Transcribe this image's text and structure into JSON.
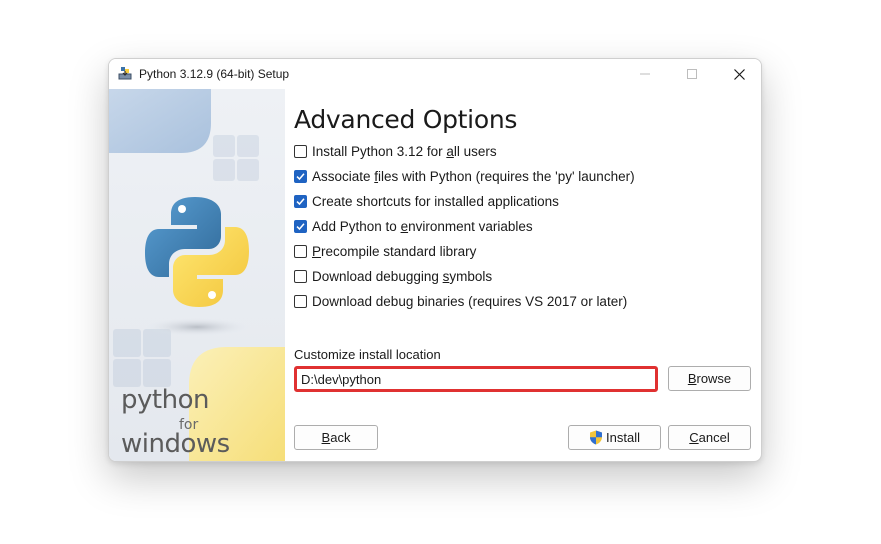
{
  "window": {
    "title": "Python 3.12.9 (64-bit) Setup"
  },
  "banner": {
    "word_python": "python",
    "word_for": "for",
    "word_windows": "windows"
  },
  "page": {
    "heading": "Advanced Options"
  },
  "options": [
    {
      "pre": "Install Python 3.12 for ",
      "key": "a",
      "post": "ll users",
      "checked": false
    },
    {
      "pre": "Associate ",
      "key": "f",
      "post": "iles with Python (requires the 'py' launcher)",
      "checked": true
    },
    {
      "pre": "Create shortcuts for installed applications",
      "key": "",
      "post": "",
      "checked": true
    },
    {
      "pre": "Add Python to ",
      "key": "e",
      "post": "nvironment variables",
      "checked": true
    },
    {
      "pre": "",
      "key": "P",
      "post": "recompile standard library",
      "checked": false
    },
    {
      "pre": "Download debugging ",
      "key": "s",
      "post": "ymbols",
      "checked": false
    },
    {
      "pre": "Download debu",
      "key": "g",
      "post": " binaries (requires VS 2017 or later)",
      "checked": false
    }
  ],
  "location": {
    "label": "Customize install location",
    "value": "D:\\dev\\python",
    "highlight_color": "#e03131"
  },
  "buttons": {
    "browse": {
      "key": "B",
      "rest": "rowse"
    },
    "back": {
      "key": "B",
      "rest": "ack"
    },
    "install": {
      "label": "Install"
    },
    "cancel": {
      "key": "C",
      "rest": "ancel"
    }
  },
  "colors": {
    "accent": "#1f63c2",
    "python_blue": "#3b73a8",
    "python_yellow": "#f7cd3c"
  }
}
